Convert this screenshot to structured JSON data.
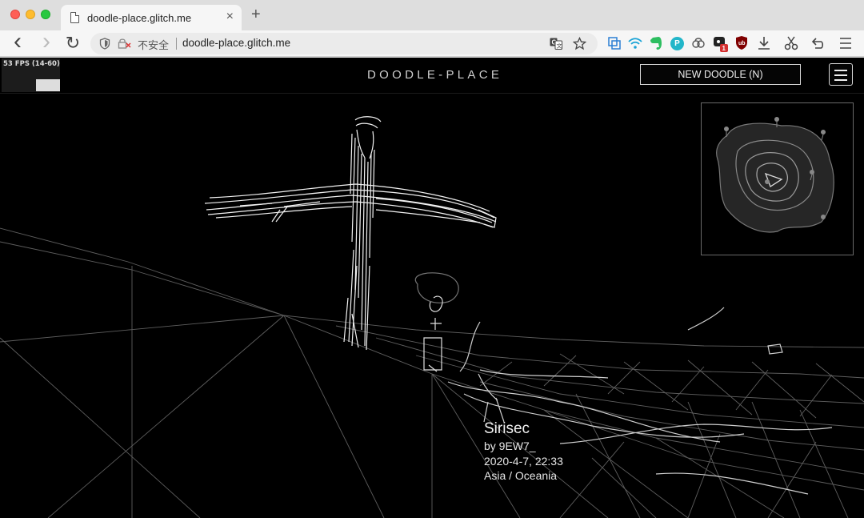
{
  "tab": {
    "title": "doodle-place.glitch.me",
    "close_icon": "×",
    "new_tab_icon": "+"
  },
  "toolbar": {
    "back_icon": "‹",
    "forward_icon": "›",
    "reload_icon": "↻",
    "security_label": "不安全",
    "url": "doodle-place.glitch.me"
  },
  "extensions": [
    "translate-icon",
    "star-icon",
    "evernote-icon",
    "wifi-icon",
    "elephant-icon",
    "p-icon",
    "cloud-icon",
    "puzzle-icon",
    "ublock-icon",
    "download-icon",
    "scissors-icon",
    "undo-icon",
    "menu-icon"
  ],
  "page": {
    "fps_label": "53 FPS (14-60)",
    "logo": "DOODLE-PLACE",
    "new_doodle_label": "NEW DOODLE (N)"
  },
  "doodle_info": {
    "title": "Sirisec",
    "author": "by 9EW7_",
    "date": "2020-4-7, 22:33",
    "region": "Asia / Oceania"
  }
}
